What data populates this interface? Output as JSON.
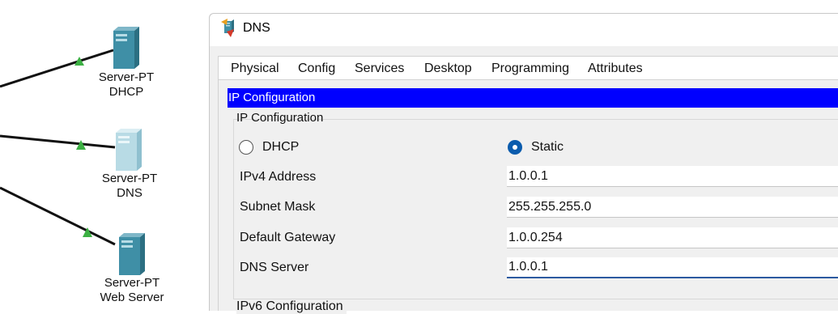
{
  "topology": {
    "devices": [
      {
        "model": "Server-PT",
        "name": "DHCP"
      },
      {
        "model": "Server-PT",
        "name": "DNS"
      },
      {
        "model": "Server-PT",
        "name": "Web Server"
      }
    ]
  },
  "window": {
    "title": "DNS",
    "tabs": [
      "Physical",
      "Config",
      "Services",
      "Desktop",
      "Programming",
      "Attributes"
    ],
    "active_tab": "Desktop"
  },
  "ip_config": {
    "header": "IP Configuration",
    "group_title": "IP Configuration",
    "mode_options": {
      "dhcp": "DHCP",
      "static": "Static"
    },
    "selected_mode": "Static",
    "fields": {
      "ipv4": {
        "label": "IPv4 Address",
        "value": "1.0.0.1"
      },
      "subnet": {
        "label": "Subnet Mask",
        "value": "255.255.255.0"
      },
      "gateway": {
        "label": "Default Gateway",
        "value": "1.0.0.254"
      },
      "dns": {
        "label": "DNS Server",
        "value": "1.0.0.1"
      }
    },
    "ipv6_title": "IPv6 Configuration"
  },
  "colors": {
    "header_blue": "#0000ff",
    "radio_selected": "#0b5cad",
    "server_teal": "#3f8fa6",
    "link_green": "#3cb043"
  }
}
